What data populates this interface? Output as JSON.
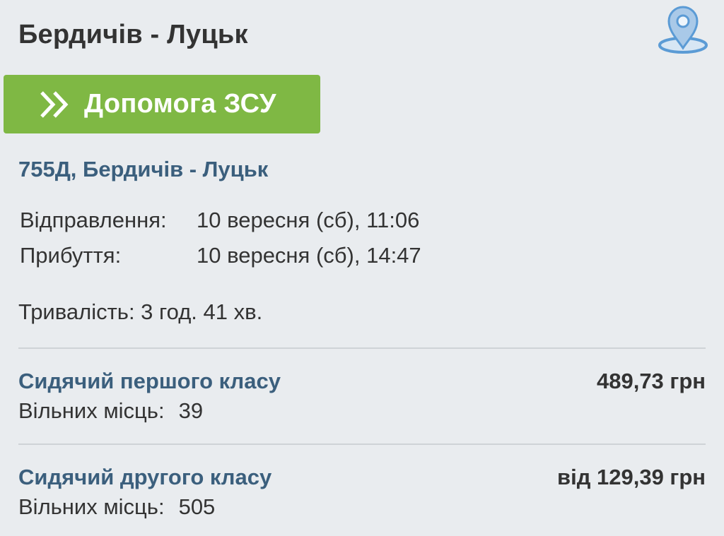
{
  "header": {
    "title": "Бердичів - Луцьк",
    "map_icon": "map-pin-icon"
  },
  "help_button": {
    "label": "Допомога ЗСУ",
    "icon": "double-chevron-right-icon",
    "color": "#7fb844"
  },
  "train": {
    "title": "755Д, Бердичів - Луцьк",
    "departure_label": "Відправлення:",
    "departure_value": "10 вересня (сб), 11:06",
    "arrival_label": "Прибуття:",
    "arrival_value": "10 вересня (сб), 14:47",
    "duration": "Тривалість: 3 год. 41 хв."
  },
  "seats": [
    {
      "name": "Сидячий першого класу",
      "price": "489,73 грн",
      "free_label": "Вільних місць:",
      "free_value": "39"
    },
    {
      "name": "Сидячий другого класу",
      "price": "від 129,39 грн",
      "free_label": "Вільних місць:",
      "free_value": "505"
    }
  ],
  "colors": {
    "background": "#e9ecef",
    "link": "#3b5f7d",
    "accent_green": "#7fb844",
    "pin_blue": "#5b9bd5"
  }
}
